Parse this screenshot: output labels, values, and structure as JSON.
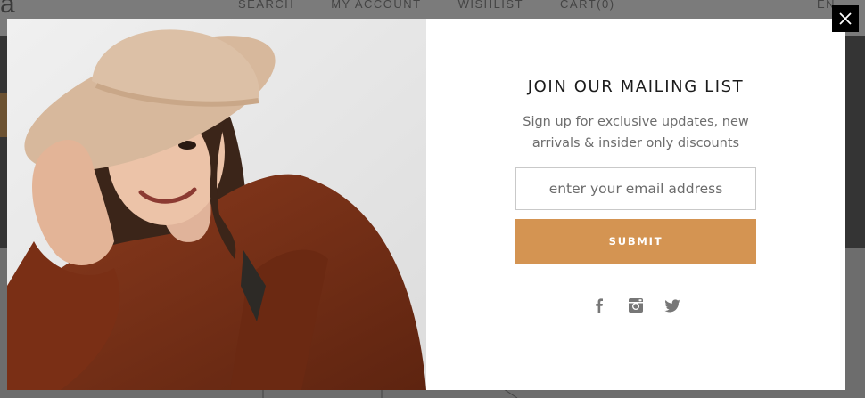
{
  "background_page": {
    "logo_letter": "a",
    "nav": [
      "SEARCH",
      "MY ACCOUNT",
      "WISHLIST",
      "CART(0)"
    ],
    "language": "EN"
  },
  "popup": {
    "title": "JOIN OUR MAILING LIST",
    "subtitle": "Sign up for exclusive updates, new arrivals & insider only discounts",
    "email_placeholder": "enter your email address",
    "submit_label": "SUBMIT",
    "social_icons": [
      "facebook-icon",
      "instagram-icon",
      "twitter-icon"
    ],
    "colors": {
      "submit_background": "#d49452",
      "close_background": "#000000",
      "overlay": "#6f6f6f"
    }
  }
}
